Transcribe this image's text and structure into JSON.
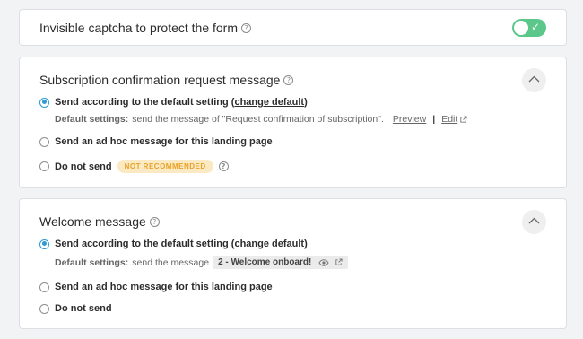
{
  "captcha": {
    "title": "Invisible captcha to protect the form",
    "help_icon": "?",
    "toggle_on": true,
    "toggle_color": "#5cc78a",
    "toggle_check": "✓"
  },
  "subscription": {
    "title": "Subscription confirmation request message",
    "help_icon": "?",
    "options": {
      "default_prefix": "Send according to the default setting (",
      "default_link": "change default",
      "default_suffix": ")",
      "adhoc": "Send an ad hoc message for this landing page",
      "none": "Do not send"
    },
    "selected": "default",
    "default_settings_label": "Default settings:",
    "default_settings_text": "send the message of \"Request confirmation of subscription\".",
    "preview_label": "Preview",
    "separator": "|",
    "edit_label": "Edit",
    "badge": "NOT RECOMMENDED",
    "badge_help_icon": "?"
  },
  "welcome": {
    "title": "Welcome message",
    "help_icon": "?",
    "options": {
      "default_prefix": "Send according to the default setting (",
      "default_link": "change default",
      "default_suffix": ")",
      "adhoc": "Send an ad hoc message for this landing page",
      "none": "Do not send"
    },
    "selected": "default",
    "default_settings_label": "Default settings:",
    "default_settings_text": "send the message",
    "message_chip": "2 - Welcome onboard!"
  },
  "colors": {
    "accent": "#2d9ad6",
    "badge_bg": "#fbe9c3",
    "badge_text": "#e8a326"
  }
}
